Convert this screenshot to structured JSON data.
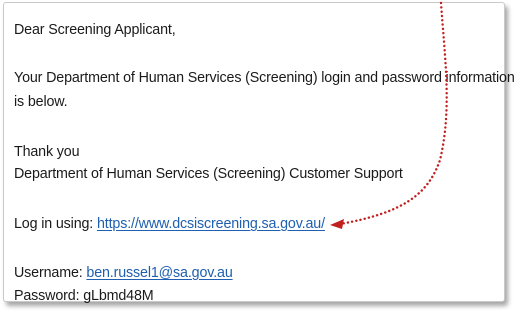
{
  "email": {
    "greeting": "Dear Screening Applicant,",
    "intro_line1": "Your Department of Human Services (Screening) login and password information",
    "intro_line2": "is below.",
    "thanks": "Thank you",
    "signature": "Department of Human Services (Screening) Customer Support",
    "login_label": "Log in using: ",
    "login_url": "https://www.dcsiscreening.sa.gov.au/",
    "username_label": "Username: ",
    "username_value": "ben.russel1@sa.gov.au",
    "password_label": "Password: ",
    "password_value": "gLbmd48M"
  },
  "annotation": {
    "arrow_color": "#c0201e",
    "style": "dotted"
  }
}
